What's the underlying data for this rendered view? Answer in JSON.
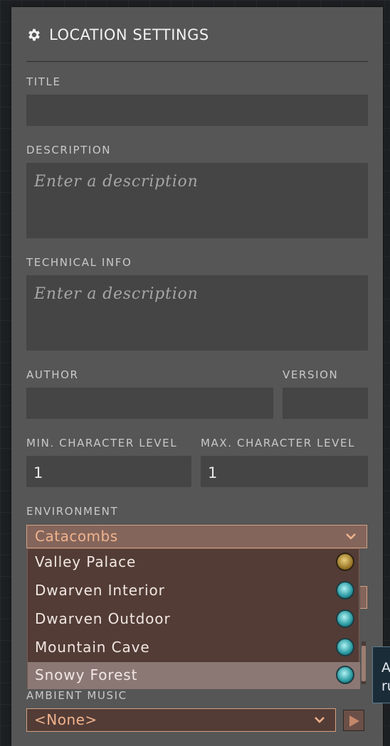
{
  "header": {
    "title": "LOCATION SETTINGS",
    "icon": "gear-icon"
  },
  "fields": {
    "title": {
      "label": "TITLE",
      "value": ""
    },
    "description": {
      "label": "DESCRIPTION",
      "placeholder": "Enter a description"
    },
    "technical_info": {
      "label": "TECHNICAL INFO",
      "placeholder": "Enter a description"
    },
    "author": {
      "label": "AUTHOR",
      "value": ""
    },
    "version": {
      "label": "VERSION",
      "value": ""
    },
    "min_level": {
      "label": "MIN. CHARACTER LEVEL",
      "value": "1"
    },
    "max_level": {
      "label": "MAX. CHARACTER LEVEL",
      "value": "1"
    }
  },
  "environment": {
    "label": "ENVIRONMENT",
    "selected": "Catacombs",
    "options": [
      {
        "label": "Valley Palace",
        "icon": "gold-medallion-icon"
      },
      {
        "label": "Dwarven Interior",
        "icon": "teal-medallion-icon"
      },
      {
        "label": "Dwarven Outdoor",
        "icon": "teal-medallion-icon"
      },
      {
        "label": "Mountain Cave",
        "icon": "teal-medallion-icon"
      },
      {
        "label": "Snowy Forest",
        "icon": "teal-medallion-icon"
      }
    ],
    "highlighted_option": "Snowy Forest"
  },
  "ambient_music": {
    "label": "AMBIENT MUSIC",
    "selected": "<None>"
  },
  "tooltip": {
    "line1": "A",
    "line2": "ru"
  },
  "colors": {
    "panel": "#565656",
    "field": "#454545",
    "accent": "#d3a081",
    "select_text": "#f0b38d",
    "dropdown": "#533c36"
  }
}
